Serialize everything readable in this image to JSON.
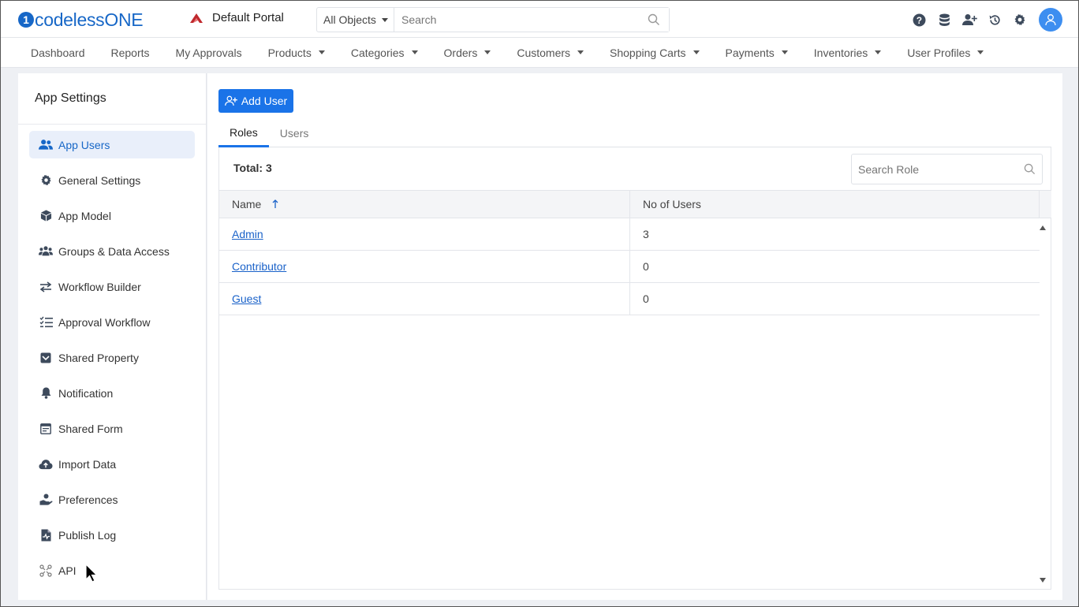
{
  "header": {
    "logo_mark": "1",
    "logo_text": "codelessONE",
    "portal_name": "Default Portal",
    "search_scope": "All Objects",
    "search_placeholder": "Search",
    "icons": [
      "help-icon",
      "database-icon",
      "add-user-icon",
      "history-icon",
      "settings-icon",
      "avatar-icon"
    ]
  },
  "nav": {
    "items": [
      {
        "label": "Dashboard",
        "dropdown": false
      },
      {
        "label": "Reports",
        "dropdown": false
      },
      {
        "label": "My Approvals",
        "dropdown": false
      },
      {
        "label": "Products",
        "dropdown": true
      },
      {
        "label": "Categories",
        "dropdown": true
      },
      {
        "label": "Orders",
        "dropdown": true
      },
      {
        "label": "Customers",
        "dropdown": true
      },
      {
        "label": "Shopping Carts",
        "dropdown": true
      },
      {
        "label": "Payments",
        "dropdown": true
      },
      {
        "label": "Inventories",
        "dropdown": true
      },
      {
        "label": "User Profiles",
        "dropdown": true
      }
    ]
  },
  "sidebar": {
    "title": "App Settings",
    "items": [
      {
        "label": "App Users",
        "icon": "users-icon",
        "active": true
      },
      {
        "label": "General Settings",
        "icon": "gear-icon"
      },
      {
        "label": "App Model",
        "icon": "cube-icon"
      },
      {
        "label": "Groups & Data Access",
        "icon": "group-icon"
      },
      {
        "label": "Workflow Builder",
        "icon": "arrows-icon"
      },
      {
        "label": "Approval Workflow",
        "icon": "checklist-icon"
      },
      {
        "label": "Shared Property",
        "icon": "inbox-icon"
      },
      {
        "label": "Notification",
        "icon": "bell-icon"
      },
      {
        "label": "Shared Form",
        "icon": "form-icon"
      },
      {
        "label": "Import Data",
        "icon": "cloud-upload-icon"
      },
      {
        "label": "Preferences",
        "icon": "hand-user-icon"
      },
      {
        "label": "Publish Log",
        "icon": "file-log-icon"
      },
      {
        "label": "API",
        "icon": "api-icon"
      }
    ]
  },
  "main": {
    "add_button": "Add User",
    "tabs": [
      {
        "label": "Roles",
        "active": true
      },
      {
        "label": "Users",
        "active": false
      }
    ],
    "total_label": "Total: 3",
    "role_search_placeholder": "Search Role",
    "columns": [
      "Name",
      "No of Users"
    ],
    "rows": [
      {
        "name": "Admin",
        "users": "3"
      },
      {
        "name": "Contributor",
        "users": "0"
      },
      {
        "name": "Guest",
        "users": "0"
      }
    ]
  },
  "colors": {
    "brand": "#1767c7",
    "primary_button": "#1a73e8",
    "active_item_bg": "#e9effa"
  }
}
